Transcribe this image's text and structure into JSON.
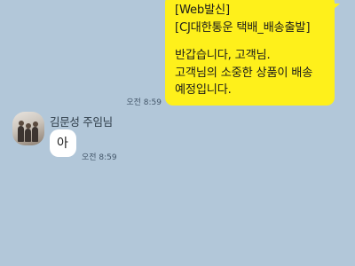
{
  "outgoing": {
    "lines": [
      "[Web발신]",
      "[CJ대한통운 택배_배송출발]",
      "반갑습니다, 고객님.",
      "고객님의 소중한 상품이 배송",
      "예정입니다."
    ],
    "time": "오전 8:59",
    "bubble_color": "#fef01b"
  },
  "incoming": {
    "sender": "김문성 주임님",
    "message": "아",
    "time": "오전 8:59",
    "bubble_color": "#ffffff"
  },
  "colors": {
    "background": "#b2c7d9"
  }
}
